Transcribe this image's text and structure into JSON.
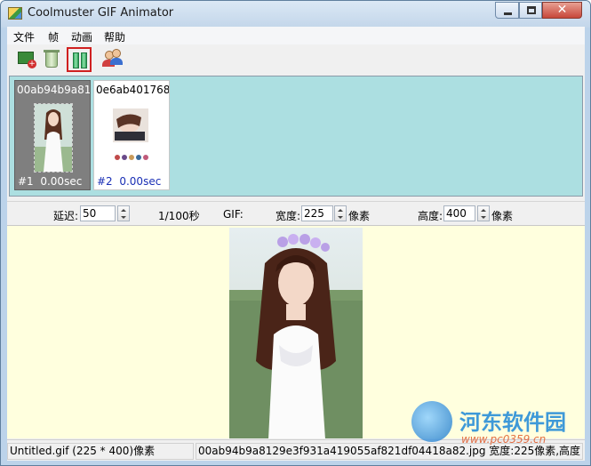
{
  "window": {
    "title": "Coolmuster GIF Animator",
    "close_glyph": "✕"
  },
  "menu": {
    "items": [
      "文件",
      "帧",
      "动画",
      "帮助"
    ]
  },
  "toolbar": {
    "icons": [
      "add-frame-icon",
      "delete-frame-icon",
      "play-pause-icon",
      "users-icon"
    ],
    "selected": "play-pause-icon"
  },
  "frames": [
    {
      "name": "00ab94b9a81",
      "index": "#1",
      "delay": "0.00sec",
      "selected": true
    },
    {
      "name": "0e6ab401768",
      "index": "#2",
      "delay": "0.00sec",
      "selected": false
    }
  ],
  "settings": {
    "delay_label": "延迟:",
    "delay_value": "50",
    "unit_label": "1/100秒",
    "gif_label": "GIF:",
    "width_label": "宽度:",
    "width_value": "225",
    "width_unit": "像素",
    "height_label": "高度:",
    "height_value": "400",
    "height_unit": "像素"
  },
  "status": {
    "file": "Untitled.gif (225 * 400)像素",
    "frame_info": "00ab94b9a8129e3f931a419055af821df04418a82.jpg 宽度:225像素,高度"
  },
  "watermark": {
    "text": "河东软件园",
    "url": "www.pc0359.cn"
  },
  "colors": {
    "frames_background": "#acdfe1",
    "preview_background": "#ffffde",
    "selected_frame": "#7f7f7f",
    "frame_index_blue": "#1a2fb5",
    "selected_tool_border": "#d02020"
  }
}
